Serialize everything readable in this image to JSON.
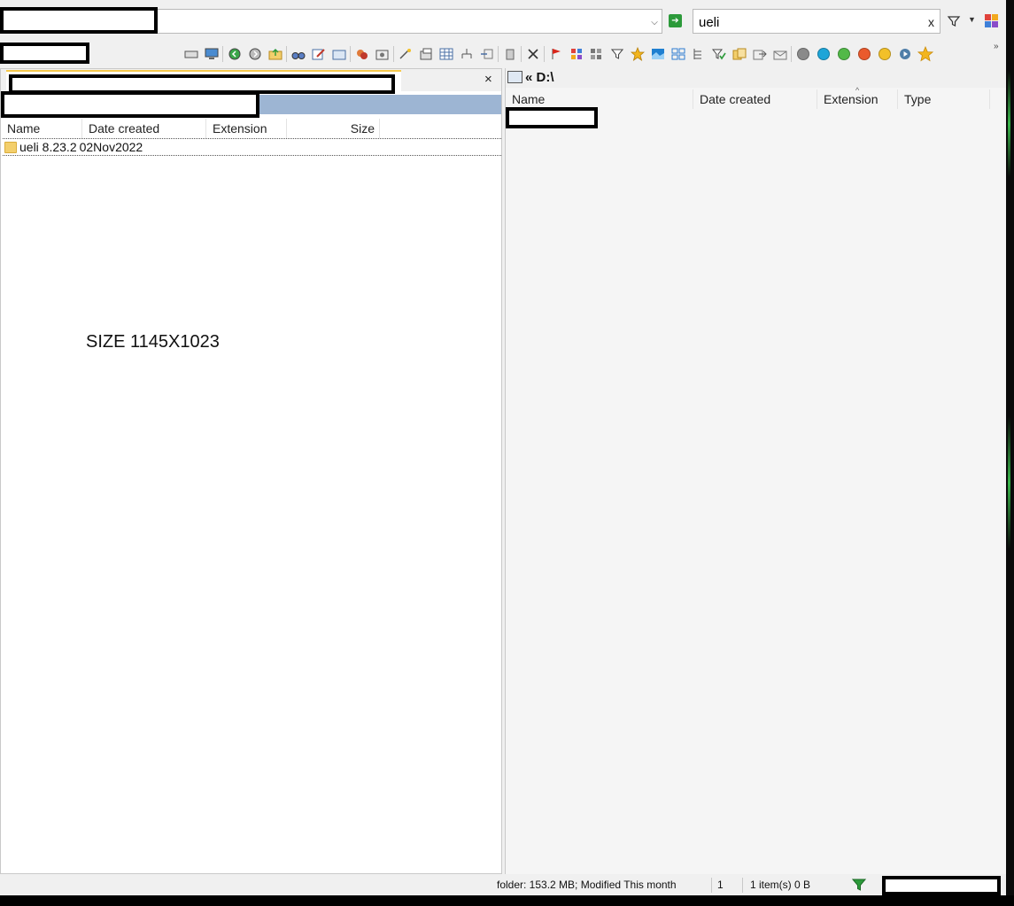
{
  "address": {
    "value": "",
    "dropdown_glyph": "⌵"
  },
  "search": {
    "value": "ueli",
    "clear_label": "x"
  },
  "toolbar": {
    "icons": [
      "drive-icon",
      "computer-icon",
      "back-icon",
      "forward-icon",
      "up-folder-icon",
      "find-icon",
      "edit-icon",
      "folder-icon",
      "tags-icon",
      "properties-icon",
      "select-icon",
      "options-icon",
      "grid-view-icon",
      "tree-icon",
      "copy-path-icon",
      "recycle-icon",
      "delete-icon",
      "flag-icon",
      "color-palette-icon",
      "filter-grid-icon",
      "filter-icon",
      "star-icon",
      "view-icon",
      "layout-icon",
      "hierarchy-icon",
      "filter-check-icon",
      "copy-icon",
      "move-icon",
      "envelope-icon"
    ],
    "color_dots": [
      "#8a8a8a",
      "#1ea5d8",
      "#52b948",
      "#ea5a2d",
      "#f2c029",
      "#4f7ea8"
    ],
    "colors": {
      "star": "#f2b51e",
      "accent_green": "#2c9a3a"
    }
  },
  "left_pane": {
    "close_label": "×",
    "columns": [
      "Name",
      "Date created",
      "Extension",
      "Size"
    ],
    "rows": [
      {
        "name": "ueli 8.23.2",
        "date_created": "02Nov2022",
        "extension": "",
        "size": ""
      }
    ],
    "annotation": "SIZE 1145X1023"
  },
  "right_pane": {
    "path": "D:\\",
    "path_prefix": "«",
    "columns": [
      "Name",
      "Date created",
      "Extension",
      "Type"
    ]
  },
  "status": {
    "folder_info": "folder: 153.2 MB; Modified This month",
    "count": "1",
    "selection": "1 item(s) 0 B"
  }
}
